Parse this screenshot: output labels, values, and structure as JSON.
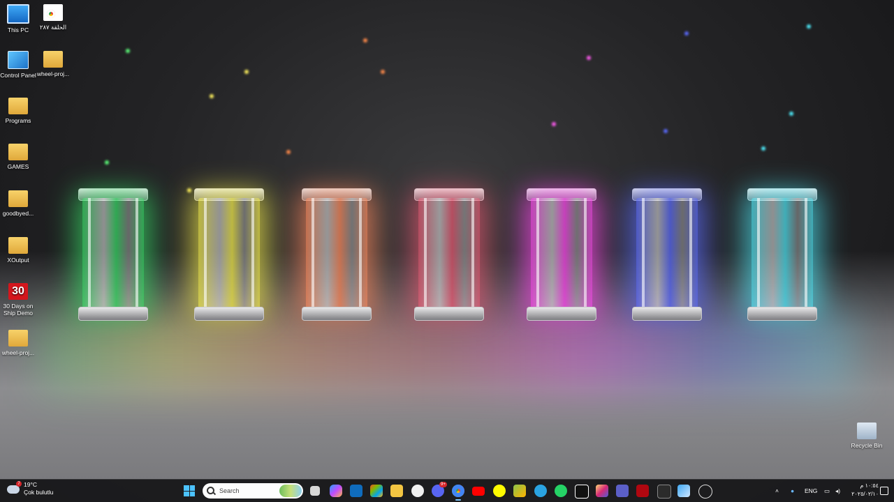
{
  "desktop": {
    "icons": [
      {
        "label": "This PC",
        "icon": "monitor-icon"
      },
      {
        "label": "الحلقة ٢٨٧",
        "icon": "chrome-file-icon"
      },
      {
        "label": "Control Panel",
        "icon": "control-panel-icon"
      },
      {
        "label": "wheel-proj...",
        "icon": "folder-icon"
      },
      {
        "label": "Programs",
        "icon": "folder-icon"
      },
      {
        "label": "GAMES",
        "icon": "folder-icon"
      },
      {
        "label": "goodbyed...",
        "icon": "folder-icon"
      },
      {
        "label": "XOutput",
        "icon": "folder-icon"
      },
      {
        "label": "30 Days on Ship Demo",
        "icon": "game-30-icon"
      },
      {
        "label": "wheel-proj...",
        "icon": "folder-icon"
      },
      {
        "label": "Recycle Bin",
        "icon": "recycle-bin-icon"
      }
    ],
    "wallpaper_colors": [
      "#38e86a",
      "#f6ef4a",
      "#ff8a5c",
      "#ff5b78",
      "#ff47f0",
      "#5b6bff",
      "#4ff0ff"
    ]
  },
  "taskbar": {
    "weather": {
      "temp": "19°C",
      "condition": "Çok bulutlu",
      "badge": "7"
    },
    "search_placeholder": "Search",
    "apps": [
      "task-view-icon",
      "copilot-icon",
      "outlook-icon",
      "store-icon",
      "file-explorer-icon",
      "obs-icon",
      "discord-icon",
      "chrome-icon",
      "youtube-icon",
      "snapchat-icon",
      "xbox-icon",
      "telegram-icon",
      "whatsapp-icon",
      "capcut-icon",
      "instagram-icon",
      "teams-icon",
      "netflix-icon",
      "terminal-icon",
      "control-icon",
      "clock-app-icon"
    ],
    "discord_badge": "9+",
    "tray": {
      "language": "ENG"
    },
    "clock": {
      "time": "١٠:٥٤ م",
      "date": "٢٠٢٥/٠٢/١٠"
    }
  }
}
